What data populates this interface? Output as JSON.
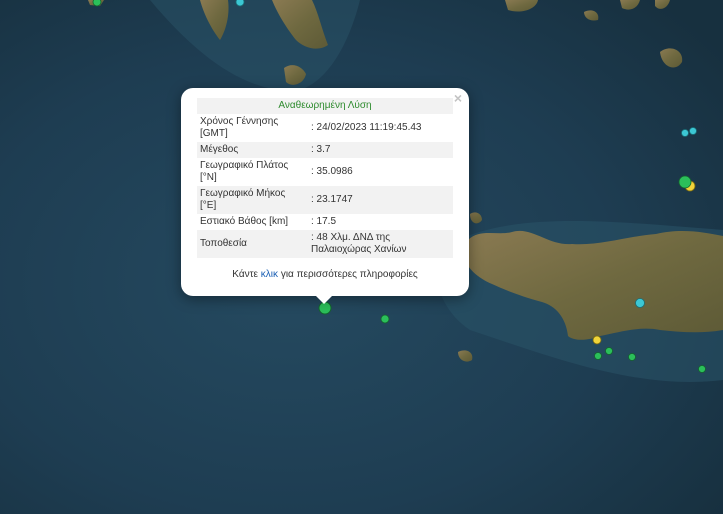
{
  "popup": {
    "heading": "Αναθεωρημένη Λύση",
    "close_label": "×",
    "rows": [
      {
        "label": "Χρόνος Γέννησης [GMT]",
        "value": ": 24/02/2023 11:19:45.43"
      },
      {
        "label": "Μέγεθος",
        "value": ": 3.7"
      },
      {
        "label": "Γεωγραφικό Πλάτος [°N]",
        "value": ": 35.0986"
      },
      {
        "label": "Γεωγραφικό Μήκος [°E]",
        "value": ": 23.1747"
      },
      {
        "label": "Εστιακό Βάθος [km]",
        "value": ": 17.5"
      },
      {
        "label": "Τοποθεσία",
        "value": ": 48 Χλμ. ΔΝΔ της Παλαιοχώρας Χανίων"
      }
    ],
    "footer_pre": "Κάντε",
    "footer_link": "κλικ",
    "footer_post": "για περισσότερες πληροφορίες"
  },
  "colors": {
    "sea": "#1d3a4e",
    "land": "#7a6a45",
    "marker_green": "#2bbf5a",
    "marker_cyan": "#3cc7d4",
    "marker_yellow": "#f0d43a",
    "heading_green": "#2e8b2e"
  }
}
